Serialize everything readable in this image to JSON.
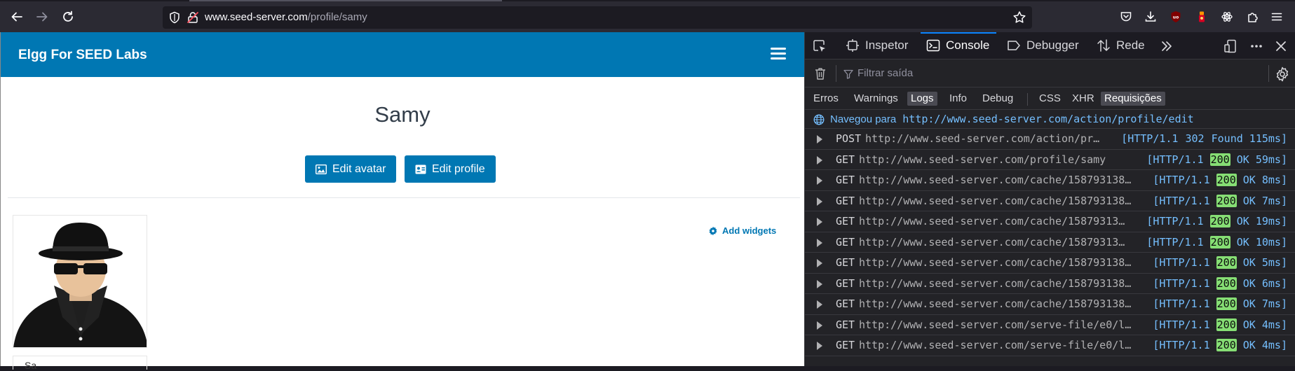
{
  "browser": {
    "url_host": "www.seed-server.com",
    "url_path": "/profile/samy"
  },
  "elgg": {
    "site_name": "Elgg For SEED Labs",
    "profile_name": "Samy",
    "edit_avatar_label": "Edit avatar",
    "edit_profile_label": "Edit profile",
    "add_widgets_label": "Add widgets",
    "name_box_text": "Sa"
  },
  "devtools": {
    "tabs": {
      "inspector": "Inspetor",
      "console": "Console",
      "debugger": "Debugger",
      "network": "Rede"
    },
    "filter_placeholder": "Filtrar saída",
    "levels": {
      "errors": "Erros",
      "warnings": "Warnings",
      "logs": "Logs",
      "info": "Info",
      "debug": "Debug",
      "css": "CSS",
      "xhr": "XHR",
      "requests": "Requisições"
    },
    "nav_label": "Navegou para",
    "nav_url": "http://www.seed-server.com/action/profile/edit",
    "logs": [
      {
        "method": "POST",
        "url": "http://www.seed-server.com/action/pr…",
        "proto": "[HTTP/1.1",
        "code": "302",
        "rest": "Found 115ms]"
      },
      {
        "method": "GET",
        "url": "http://www.seed-server.com/profile/samy",
        "proto": "[HTTP/1.1",
        "code": "200",
        "rest": "OK 59ms]"
      },
      {
        "method": "GET",
        "url": "http://www.seed-server.com/cache/158793138…",
        "proto": "[HTTP/1.1",
        "code": "200",
        "rest": "OK 8ms]"
      },
      {
        "method": "GET",
        "url": "http://www.seed-server.com/cache/158793138…",
        "proto": "[HTTP/1.1",
        "code": "200",
        "rest": "OK 7ms]"
      },
      {
        "method": "GET",
        "url": "http://www.seed-server.com/cache/15879313…",
        "proto": "[HTTP/1.1",
        "code": "200",
        "rest": "OK 19ms]"
      },
      {
        "method": "GET",
        "url": "http://www.seed-server.com/cache/15879313…",
        "proto": "[HTTP/1.1",
        "code": "200",
        "rest": "OK 10ms]"
      },
      {
        "method": "GET",
        "url": "http://www.seed-server.com/cache/158793138…",
        "proto": "[HTTP/1.1",
        "code": "200",
        "rest": "OK 5ms]"
      },
      {
        "method": "GET",
        "url": "http://www.seed-server.com/cache/158793138…",
        "proto": "[HTTP/1.1",
        "code": "200",
        "rest": "OK 6ms]"
      },
      {
        "method": "GET",
        "url": "http://www.seed-server.com/cache/158793138…",
        "proto": "[HTTP/1.1",
        "code": "200",
        "rest": "OK 7ms]"
      },
      {
        "method": "GET",
        "url": "http://www.seed-server.com/serve-file/e0/l…",
        "proto": "[HTTP/1.1",
        "code": "200",
        "rest": "OK 4ms]"
      },
      {
        "method": "GET",
        "url": "http://www.seed-server.com/serve-file/e0/l…",
        "proto": "[HTTP/1.1",
        "code": "200",
        "rest": "OK 4ms]"
      }
    ]
  },
  "colors": {
    "elgg_blue": "#0077b3",
    "status_ok": "#86de74",
    "devtools_accent": "#0a84ff"
  }
}
